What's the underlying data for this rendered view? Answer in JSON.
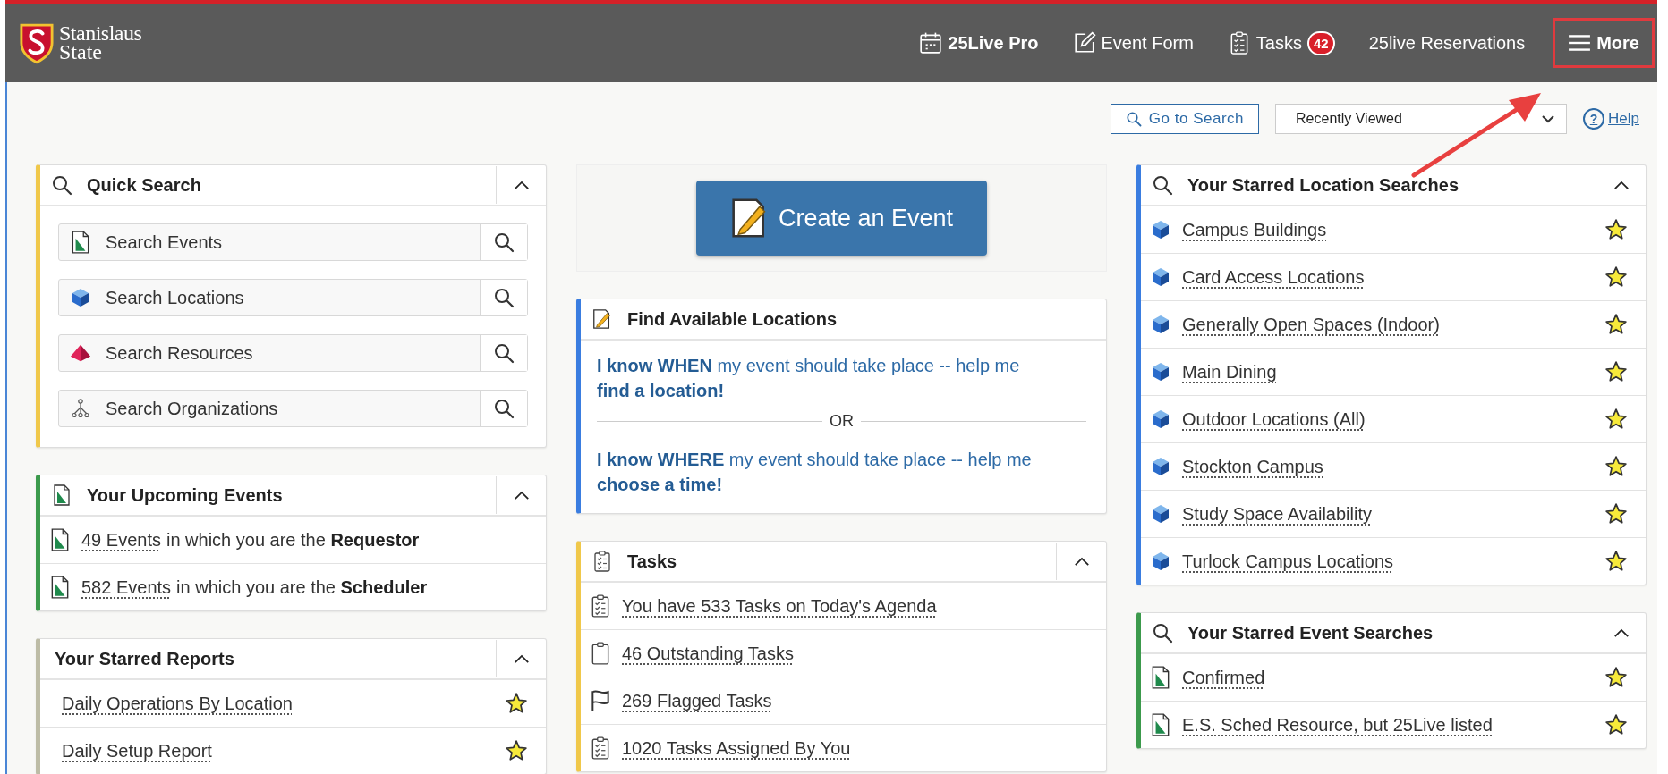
{
  "header": {
    "logo": {
      "line1": "Stanislaus",
      "line2": "State"
    },
    "nav": [
      {
        "label": "25Live Pro",
        "kind": "calendar",
        "bold": true
      },
      {
        "label": "Event Form",
        "kind": "form",
        "bold": false
      },
      {
        "label": "Tasks",
        "kind": "tasks",
        "bold": false,
        "badge": "42"
      },
      {
        "label": "25live Reservations",
        "kind": "text",
        "bold": false
      },
      {
        "label": "More",
        "kind": "menu",
        "bold": true,
        "highlighted": true
      }
    ]
  },
  "toolbar": {
    "search_button": "Go to Search",
    "dropdown": {
      "value": "Recently Viewed"
    },
    "help": {
      "icon": "?",
      "label": "Help"
    }
  },
  "columns": [
    [
      {
        "kind": "quick_search",
        "title": "Quick Search",
        "color": "#f0c84a",
        "collapsible": true,
        "fields": [
          {
            "label": "Search Events",
            "kind": "event"
          },
          {
            "label": "Search Locations",
            "kind": "location"
          },
          {
            "label": "Search Resources",
            "kind": "resource"
          },
          {
            "label": "Search Organizations",
            "kind": "organization"
          }
        ]
      },
      {
        "kind": "upcoming_events",
        "title": "Your Upcoming Events",
        "color": "#3c9a4c",
        "collapsible": true,
        "rows": [
          {
            "kind": "event",
            "link": "49 Events",
            "text": "in which you are the **Requestor**"
          },
          {
            "kind": "event",
            "link": "582 Events",
            "text": "in which you are the **Scheduler**"
          }
        ]
      },
      {
        "kind": "reports",
        "title": "Your Starred Reports",
        "color": "#bdbca6",
        "collapsible": true,
        "rows": [
          {
            "kind": "report",
            "text": "Daily Operations By Location",
            "starred": true
          },
          {
            "kind": "report",
            "text": "Daily Setup Report",
            "starred": true
          }
        ]
      }
    ],
    [
      {
        "kind": "create",
        "button": "Create an Event"
      },
      {
        "kind": "find",
        "title": "Find Available Locations",
        "color": "#3a7de0",
        "collapsible": false,
        "options": [
          "**I know WHEN** my event should take place -- help me **find a location!**",
          "**I know WHERE** my event should take place -- help me **choose a time!**"
        ],
        "separator": "OR"
      },
      {
        "kind": "tasks",
        "title": "Tasks",
        "color": "#f0c84a",
        "collapsible": true,
        "rows": [
          {
            "kind": "task_list",
            "text": "You have 533 Tasks on Today's Agenda"
          },
          {
            "kind": "outstanding",
            "text": "46 Outstanding Tasks"
          },
          {
            "kind": "flagged",
            "text": "269 Flagged Tasks"
          },
          {
            "kind": "task_list",
            "text": "1020 Tasks Assigned By You"
          }
        ]
      }
    ],
    [
      {
        "kind": "location_searches",
        "title": "Your Starred Location Searches",
        "color": "#3a7de0",
        "collapsible": true,
        "rows": [
          {
            "kind": "location",
            "text": "Campus Buildings",
            "starred": true
          },
          {
            "kind": "location",
            "text": "Card Access Locations",
            "starred": true
          },
          {
            "kind": "location",
            "text": "Generally Open Spaces (Indoor)",
            "starred": true
          },
          {
            "kind": "location",
            "text": "Main Dining",
            "starred": true
          },
          {
            "kind": "location",
            "text": "Outdoor Locations (All)",
            "starred": true
          },
          {
            "kind": "location",
            "text": "Stockton Campus",
            "starred": true
          },
          {
            "kind": "location",
            "text": "Study Space Availability",
            "starred": true
          },
          {
            "kind": "location",
            "text": "Turlock Campus Locations",
            "starred": true
          }
        ]
      },
      {
        "kind": "event_searches",
        "title": "Your Starred Event Searches",
        "color": "#3c9a4c",
        "collapsible": true,
        "rows": [
          {
            "kind": "event",
            "text": "Confirmed",
            "starred": true
          },
          {
            "kind": "event",
            "text": "E.S. Sched Resource, but 25Live listed",
            "starred": true
          }
        ]
      }
    ]
  ],
  "annotation": {
    "kind": "arrow"
  }
}
